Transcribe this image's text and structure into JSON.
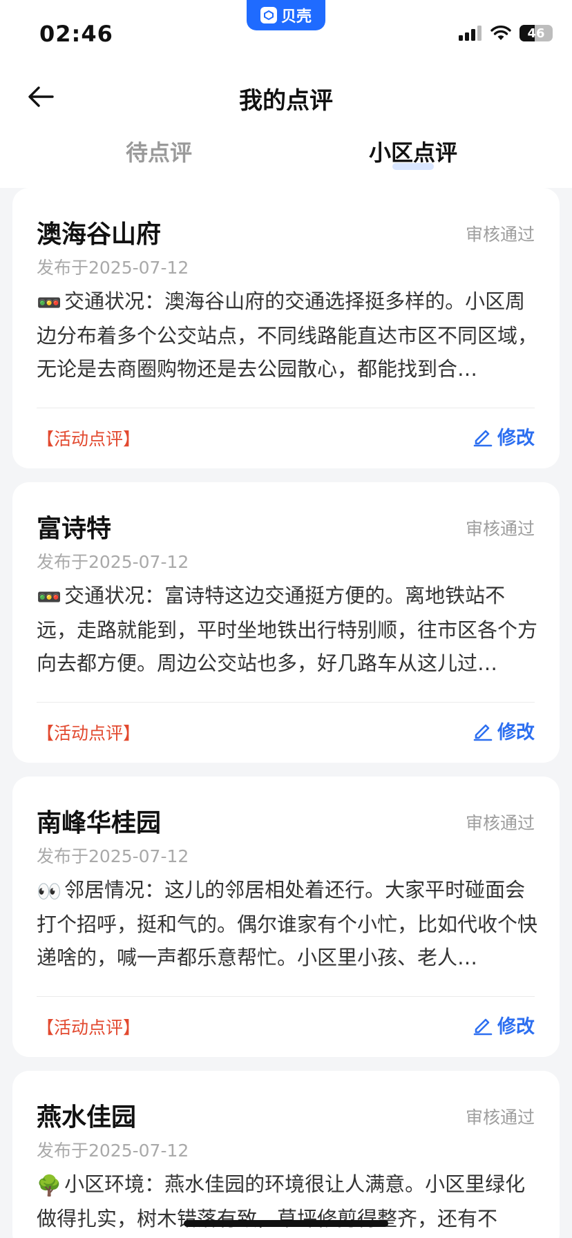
{
  "status_bar": {
    "time": "02:46",
    "app_badge": "贝壳",
    "battery": "46"
  },
  "header": {
    "title": "我的点评"
  },
  "tabs": [
    {
      "label": "待点评"
    },
    {
      "label": "小区点评"
    }
  ],
  "active_tab": 1,
  "reviews": [
    {
      "name": "澳海谷山府",
      "status": "审核通过",
      "date": "发布于2025-07-12",
      "emoji": "🚥",
      "body": "交通状况：澳海谷山府的交通选择挺多样的。小区周边分布着多个公交站点，不同线路能直达市区不同区域，无论是去商圈购物还是去公园散心，都能找到合…",
      "tag": "【活动点评】",
      "edit_label": "修改"
    },
    {
      "name": "富诗特",
      "status": "审核通过",
      "date": "发布于2025-07-12",
      "emoji": "🚥",
      "body": "交通状况：富诗特这边交通挺方便的。离地铁站不远，走路就能到，平时坐地铁出行特别顺，往市区各个方向去都方便。周边公交站也多，好几路车从这儿过…",
      "tag": "【活动点评】",
      "edit_label": "修改"
    },
    {
      "name": "南峰华桂园",
      "status": "审核通过",
      "date": "发布于2025-07-12",
      "emoji": "👀",
      "body": "邻居情况：这儿的邻居相处着还行。大家平时碰面会打个招呼，挺和气的。偶尔谁家有个小忙，比如代收个快递啥的，喊一声都乐意帮忙。小区里小孩、老人…",
      "tag": "【活动点评】",
      "edit_label": "修改"
    },
    {
      "name": "燕水佳园",
      "status": "审核通过",
      "date": "发布于2025-07-12",
      "emoji": "🌳",
      "body": "小区环境：燕水佳园的环境很让人满意。小区里绿化做得扎实，树木错落有致，草坪修剪得整齐，还有不",
      "tag": "",
      "edit_label": ""
    }
  ]
}
